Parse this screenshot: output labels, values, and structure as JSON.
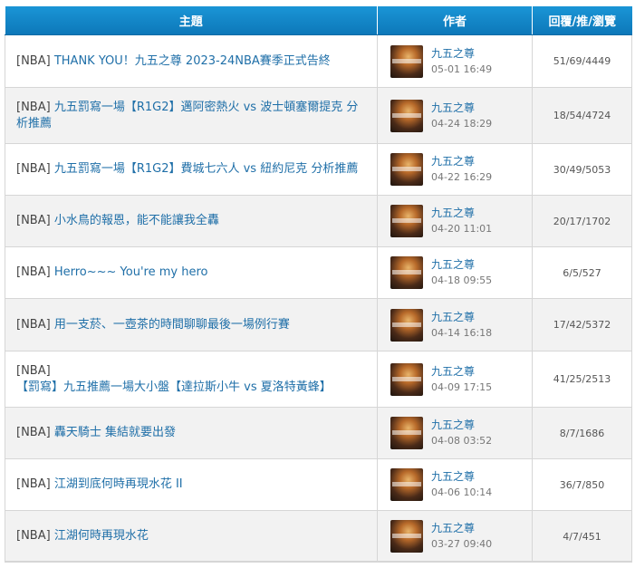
{
  "header": {
    "topic": "主題",
    "author": "作者",
    "stats": "回覆/推/瀏覽"
  },
  "rows": [
    {
      "tag": "[NBA]",
      "title": "THANK YOU！九五之尊 2023-24NBA賽季正式告終",
      "author": "九五之尊",
      "time": "05-01 16:49",
      "stats": "51/69/4449"
    },
    {
      "tag": "[NBA]",
      "title": "九五罰寫一場【R1G2】邁阿密熱火 vs 波士頓塞爾提克 分析推薦",
      "author": "九五之尊",
      "time": "04-24 18:29",
      "stats": "18/54/4724"
    },
    {
      "tag": "[NBA]",
      "title": "九五罰寫一場【R1G2】費城七六人 vs 紐約尼克 分析推薦",
      "author": "九五之尊",
      "time": "04-22 16:29",
      "stats": "30/49/5053"
    },
    {
      "tag": "[NBA]",
      "title": "小水鳥的報恩，能不能讓我全轟",
      "author": "九五之尊",
      "time": "04-20 11:01",
      "stats": "20/17/1702"
    },
    {
      "tag": "[NBA]",
      "title": "Herro~~~ You're my hero",
      "author": "九五之尊",
      "time": "04-18 09:55",
      "stats": "6/5/527"
    },
    {
      "tag": "[NBA]",
      "title": "用一支菸、一壺茶的時間聊聊最後一場例行賽",
      "author": "九五之尊",
      "time": "04-14 16:18",
      "stats": "17/42/5372"
    },
    {
      "tag": "[NBA]",
      "title": "【罰寫】九五推薦一場大小盤【達拉斯小牛 vs 夏洛特黃蜂】",
      "author": "九五之尊",
      "time": "04-09 17:15",
      "stats": "41/25/2513"
    },
    {
      "tag": "[NBA]",
      "title": "轟天騎士 集結就要出發",
      "author": "九五之尊",
      "time": "04-08 03:52",
      "stats": "8/7/1686"
    },
    {
      "tag": "[NBA]",
      "title": "江湖到底何時再現水花 II",
      "author": "九五之尊",
      "time": "04-06 10:14",
      "stats": "36/7/850"
    },
    {
      "tag": "[NBA]",
      "title": "江湖何時再現水花",
      "author": "九五之尊",
      "time": "03-27 09:40",
      "stats": "4/7/451"
    }
  ]
}
